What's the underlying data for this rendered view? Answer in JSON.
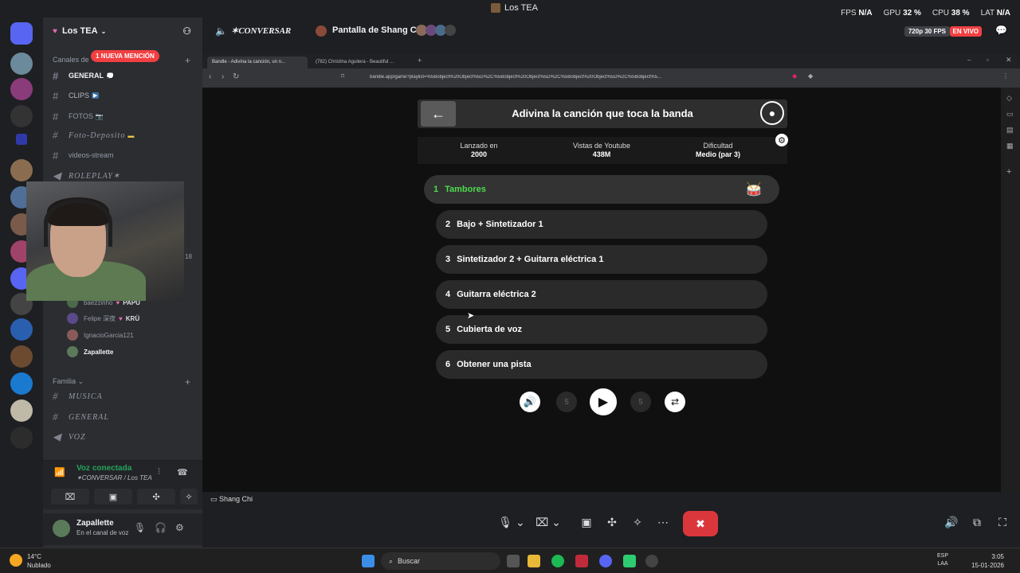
{
  "window": {
    "title": "Los TEA"
  },
  "stats": {
    "fps_label": "FPS",
    "fps": "N/A",
    "gpu_label": "GPU",
    "gpu": "32 %",
    "cpu_label": "CPU",
    "cpu": "38 %",
    "lat_label": "LAT",
    "lat": "N/A"
  },
  "server": {
    "name": "Los TEA",
    "mention": "1 NUEVA MENCIÓN"
  },
  "sidebar": {
    "category_channels": "Canales de",
    "channels": [
      {
        "name": "GENERAL",
        "style": "bold"
      },
      {
        "name": "CLIPS",
        "style": "bold"
      },
      {
        "name": "FOTOS",
        "style": "plain"
      },
      {
        "name": "Foto-Deposito",
        "style": "fancy"
      },
      {
        "name": "videos-stream",
        "style": "plain"
      },
      {
        "name": "ROLEPLAY✶",
        "style": "fancy"
      }
    ],
    "webcam_count": "18",
    "users": [
      {
        "name": "baezzinho",
        "badge": "PAPU"
      },
      {
        "name": "Felipe 深夜",
        "badge": "KRÜ"
      },
      {
        "name": "IgnacioGarcia121",
        "badge": ""
      },
      {
        "name": "Zapallette",
        "badge": ""
      }
    ],
    "category_family": "Familia",
    "family_channels": [
      {
        "name": "MUSICA"
      },
      {
        "name": "GENERAL"
      },
      {
        "name": "VOZ"
      }
    ]
  },
  "voice": {
    "status": "Voz conectada",
    "channel": "✶CONVERSAR / Los TEA"
  },
  "user": {
    "name": "Zapallette",
    "status": "En el canal de voz"
  },
  "stream_header": {
    "channel": "✶CONVERSAR",
    "stream": "Pantalla de Shang Chi",
    "quality": "720p 30 FPS",
    "live": "EN VIVO"
  },
  "browser": {
    "tabs": [
      "Bandle - Adivina la canción, un n...",
      "(782) Christina Aguilera - Beautiful ..."
    ],
    "url": "bandle.app/game?playlist=%5Bobject%20Object%5D%2C%5Bobject%20Object%5D%2C%5Bobject%20Object%5D%2C%5Bobject%5..."
  },
  "bandle": {
    "title": "Adivina la canción que toca la banda",
    "info": [
      {
        "label": "Lanzado en",
        "value": "2000"
      },
      {
        "label": "Vistas de Youtube",
        "value": "438M"
      },
      {
        "label": "Dificultad",
        "value": "Medio (par 3)"
      }
    ],
    "tracks": [
      {
        "n": "1",
        "label": "Tambores"
      },
      {
        "n": "2",
        "label": "Bajo + Sintetizador 1"
      },
      {
        "n": "3",
        "label": "Sintetizador 2 + Guitarra eléctrica 1"
      },
      {
        "n": "4",
        "label": "Guitarra eléctrica 2"
      },
      {
        "n": "5",
        "label": "Cubierta de voz"
      },
      {
        "n": "6",
        "label": "Obtener una pista"
      }
    ],
    "skip_back": "5",
    "skip_fwd": "5"
  },
  "bottom": {
    "stream_tag": "Shang Chi"
  },
  "taskbar": {
    "temp": "14°C",
    "weather": "Nublado",
    "search": "Buscar",
    "lang1": "ESP",
    "lang2": "LAA",
    "time": "3:05",
    "date": "15-01-2026"
  }
}
